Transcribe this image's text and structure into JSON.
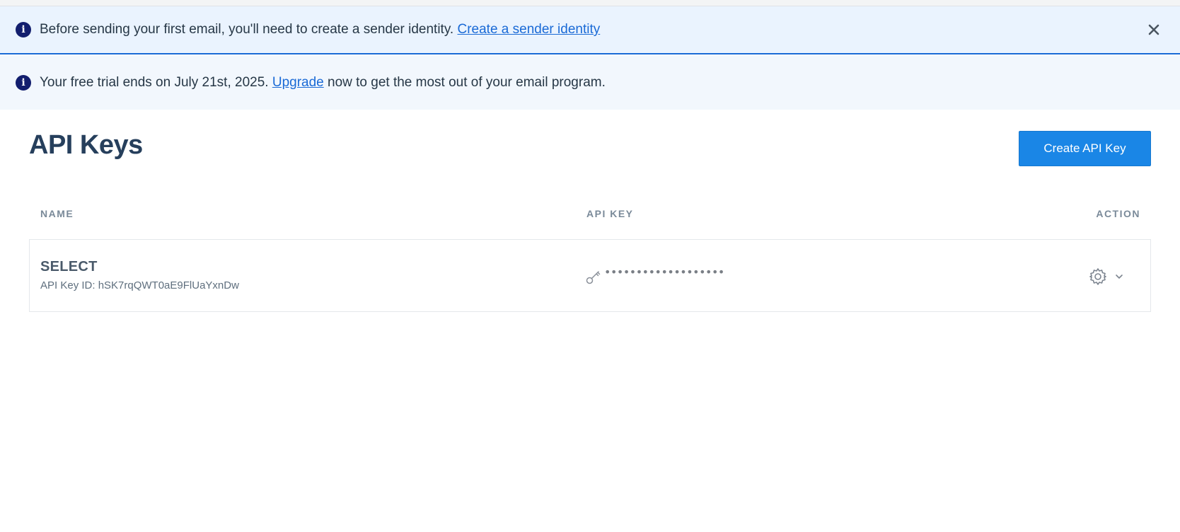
{
  "banners": {
    "sender": {
      "icon": "info-icon",
      "text": "Before sending your first email, you'll need to create a sender identity.",
      "link": "Create a sender identity",
      "close_icon": "close-icon"
    },
    "trial": {
      "icon": "info-icon",
      "text_before": "Your free trial ends on July 21st, 2025.",
      "link": "Upgrade",
      "text_after": "now to get the most out of your email program."
    }
  },
  "page": {
    "title": "API Keys",
    "create_button": "Create API Key"
  },
  "table": {
    "columns": [
      "NAME",
      "API KEY",
      "ACTION"
    ],
    "rows": [
      {
        "name": "SELECT",
        "id_text": "API Key ID: hSK7rqQWT0aE9FlUaYxnDw",
        "key_icon": "key-icon",
        "masked_key": "•••••••••••••••••••",
        "action_icons": [
          "gear-icon",
          "chevron-down-icon"
        ]
      }
    ]
  },
  "colors": {
    "accent": "#1a86e6",
    "link": "#1a6ad6",
    "info_icon": "#121e6e",
    "banner_bg": "#eaf3fe"
  }
}
